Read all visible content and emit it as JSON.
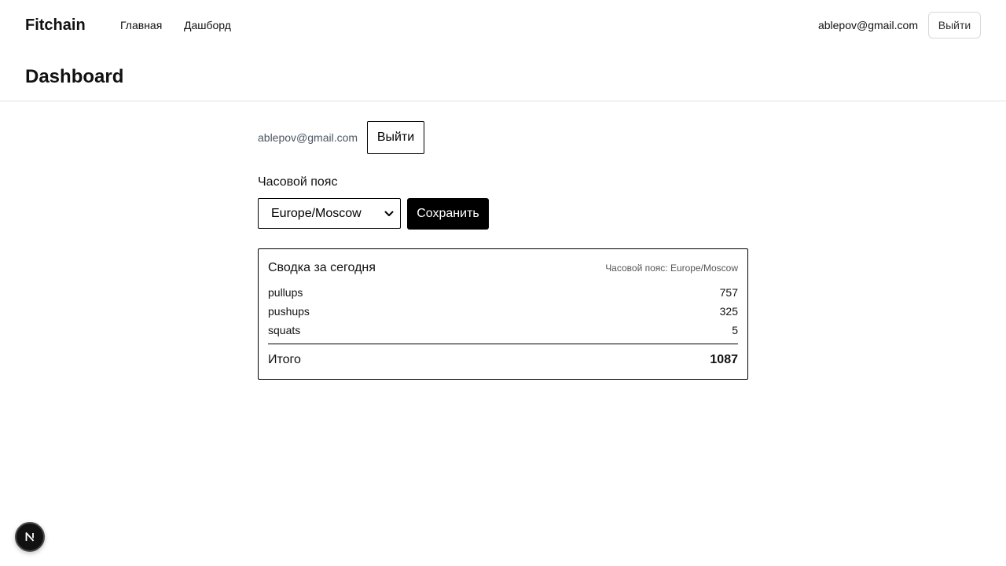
{
  "nav": {
    "brand": "Fitchain",
    "links": [
      {
        "label": "Главная"
      },
      {
        "label": "Дашборд"
      }
    ],
    "user_email": "ablepov@gmail.com",
    "logout_label": "Выйти"
  },
  "header": {
    "title": "Dashboard"
  },
  "account": {
    "email": "ablepov@gmail.com",
    "logout_label": "Выйти"
  },
  "timezone": {
    "label": "Часовой пояс",
    "selected": "Europe/Moscow",
    "save_label": "Сохранить"
  },
  "summary": {
    "title": "Сводка за сегодня",
    "timezone_note": "Часовой пояс: Europe/Moscow",
    "rows": [
      {
        "name": "pullups",
        "value": "757"
      },
      {
        "name": "pushups",
        "value": "325"
      },
      {
        "name": "squats",
        "value": "5"
      }
    ],
    "total_label": "Итого",
    "total_value": "1087"
  },
  "dev_badge": {
    "icon": "nextjs-icon"
  }
}
